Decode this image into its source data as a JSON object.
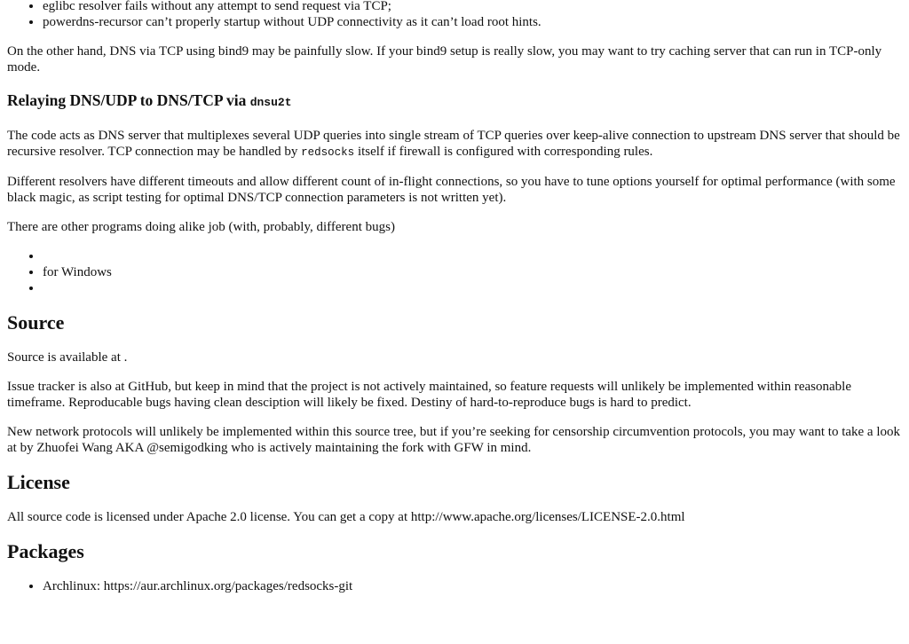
{
  "top_list": [
    "eglibc resolver fails without any attempt to send request via TCP;",
    "powerdns-recursor can’t properly startup without UDP connectivity as it can’t load root hints."
  ],
  "para_dns_tcp": "On the other hand, DNS via TCP using bind9 may be painfully slow. If your bind9 setup is really slow, you may want to try caching server that can run in TCP-only mode.",
  "relay_heading": {
    "prefix": "Relaying DNS/UDP to DNS/TCP via ",
    "code": "dnsu2t"
  },
  "para_code_acts": {
    "before": "The code acts as DNS server that multiplexes several UDP queries into single stream of TCP queries over keep-alive connection to upstream DNS server that should be recursive resolver. TCP connection may be handled by ",
    "code": "redsocks",
    "after": " itself if firewall is configured with corresponding rules."
  },
  "para_resolvers": "Different resolvers have different timeouts and allow different count of in-flight connections, so you have to tune options yourself for optimal performance (with some black magic, as script testing for optimal DNS/TCP connection parameters is not written yet).",
  "para_other_programs": "There are other programs doing alike job (with, probably, different bugs)",
  "other_programs_list": [
    "",
    "for Windows",
    ""
  ],
  "source_heading": "Source",
  "para_source": "Source is available at .",
  "para_issue": "Issue tracker is also at GitHub, but keep in mind that the project is not actively maintained, so feature requests will unlikely be implemented within reasonable timeframe. Reproducable bugs having clean desciption will likely be fixed. Destiny of hard-to-reproduce bugs is hard to predict.",
  "para_protocols": "New network protocols will unlikely be implemented within this source tree, but if you’re seeking for censorship circumvention protocols, you may want to take a look at by Zhuofei Wang AKA @semigodking who is actively maintaining the fork with GFW in mind.",
  "license_heading": "License",
  "para_license": "All source code is licensed under Apache 2.0 license. You can get a copy at http://www.apache.org/licenses/LICENSE-2.0.html",
  "packages_heading": "Packages",
  "packages_list": [
    "Archlinux: https://aur.archlinux.org/packages/redsocks-git"
  ]
}
